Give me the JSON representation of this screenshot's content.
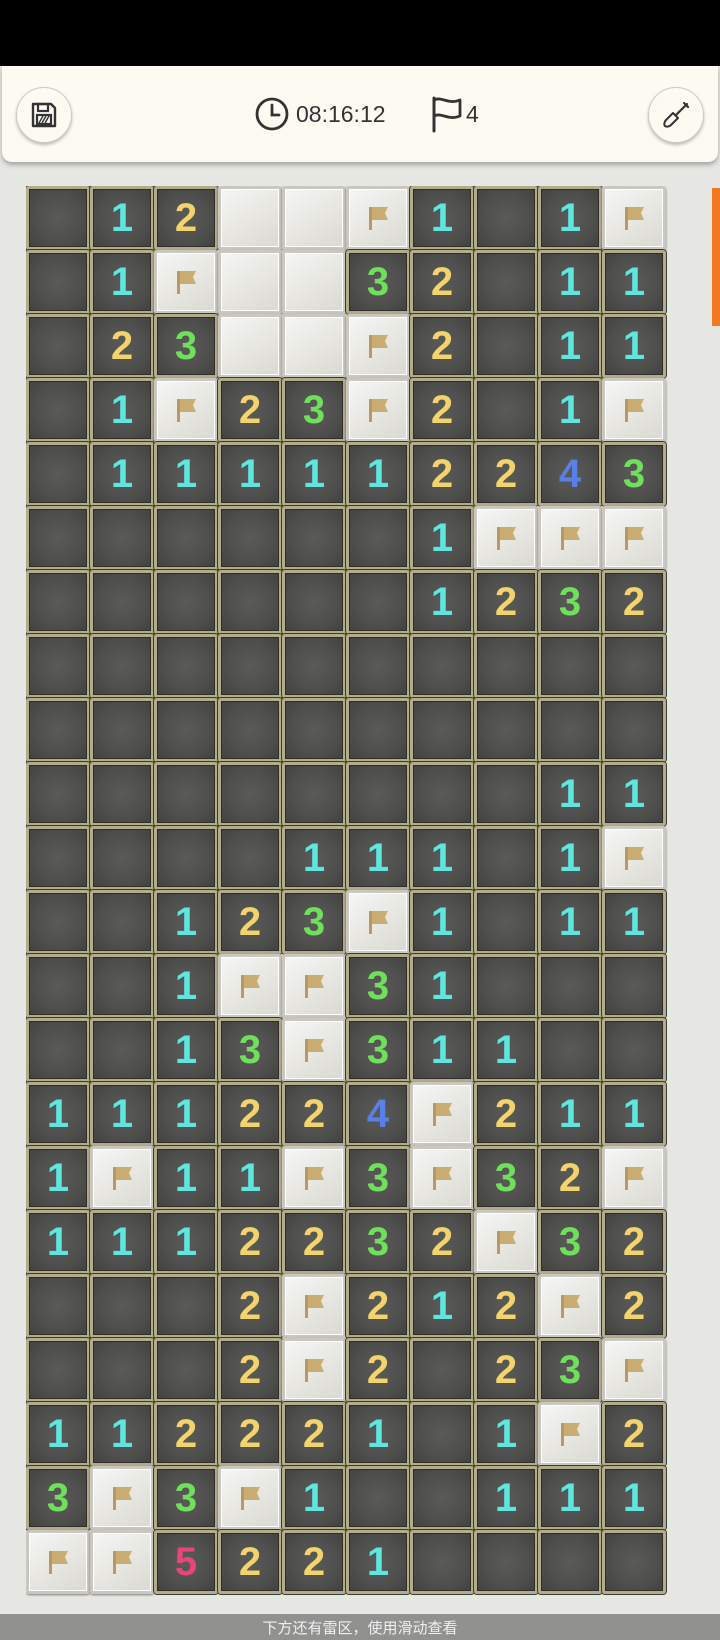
{
  "header": {
    "timer": "08:16:12",
    "flag_count": "4"
  },
  "board": {
    "rows": [
      [
        "",
        "1",
        "2",
        "H",
        "H",
        "F",
        "1",
        "",
        "1",
        "F"
      ],
      [
        "",
        "1",
        "F",
        "H",
        "H",
        "3",
        "2",
        "",
        "1",
        "1"
      ],
      [
        "",
        "2",
        "3",
        "H",
        "H",
        "F",
        "2",
        "",
        "1",
        "1"
      ],
      [
        "",
        "1",
        "F",
        "2",
        "3",
        "F",
        "2",
        "",
        "1",
        "F"
      ],
      [
        "",
        "1",
        "1",
        "1",
        "1",
        "1",
        "2",
        "2",
        "4",
        "3"
      ],
      [
        "",
        "",
        "",
        "",
        "",
        "",
        "1",
        "F",
        "F",
        "F"
      ],
      [
        "",
        "",
        "",
        "",
        "",
        "",
        "1",
        "2",
        "3",
        "2"
      ],
      [
        "",
        "",
        "",
        "",
        "",
        "",
        "",
        "",
        "",
        ""
      ],
      [
        "",
        "",
        "",
        "",
        "",
        "",
        "",
        "",
        "",
        ""
      ],
      [
        "",
        "",
        "",
        "",
        "",
        "",
        "",
        "",
        "1",
        "1"
      ],
      [
        "",
        "",
        "",
        "",
        "1",
        "1",
        "1",
        "",
        "1",
        "F"
      ],
      [
        "",
        "",
        "1",
        "2",
        "3",
        "F",
        "1",
        "",
        "1",
        "1"
      ],
      [
        "",
        "",
        "1",
        "F",
        "F",
        "3",
        "1",
        "",
        "",
        ""
      ],
      [
        "",
        "",
        "1",
        "3",
        "F",
        "3",
        "1",
        "1",
        "",
        ""
      ],
      [
        "1",
        "1",
        "1",
        "2",
        "2",
        "4",
        "F",
        "2",
        "1",
        "1"
      ],
      [
        "1",
        "F",
        "1",
        "1",
        "F",
        "3",
        "F",
        "3",
        "2",
        "F"
      ],
      [
        "1",
        "1",
        "1",
        "2",
        "2",
        "3",
        "2",
        "F",
        "3",
        "2"
      ],
      [
        "",
        "",
        "",
        "2",
        "F",
        "2",
        "1",
        "2",
        "F",
        "2"
      ],
      [
        "",
        "",
        "",
        "2",
        "F",
        "2",
        "",
        "2",
        "3",
        "F"
      ],
      [
        "1",
        "1",
        "2",
        "2",
        "2",
        "1",
        "",
        "1",
        "F",
        "2"
      ],
      [
        "3",
        "F",
        "3",
        "F",
        "1",
        "",
        "",
        "1",
        "1",
        "1"
      ],
      [
        "F",
        "F",
        "5",
        "2",
        "2",
        "1",
        "",
        "",
        "",
        ""
      ]
    ]
  },
  "footer": {
    "hint": "下方还有雷区，使用滑动查看"
  },
  "colors": {
    "accent": "#f07a24",
    "n1": "#5ee6e0",
    "n2": "#f1d46b",
    "n3": "#6fe05d",
    "n4": "#5a7fe6",
    "n5": "#e8457a",
    "flag": "#c9ad72"
  },
  "icons": {
    "save": "floppy-disk",
    "timer": "clock",
    "flags": "flag",
    "tool": "shovel"
  }
}
